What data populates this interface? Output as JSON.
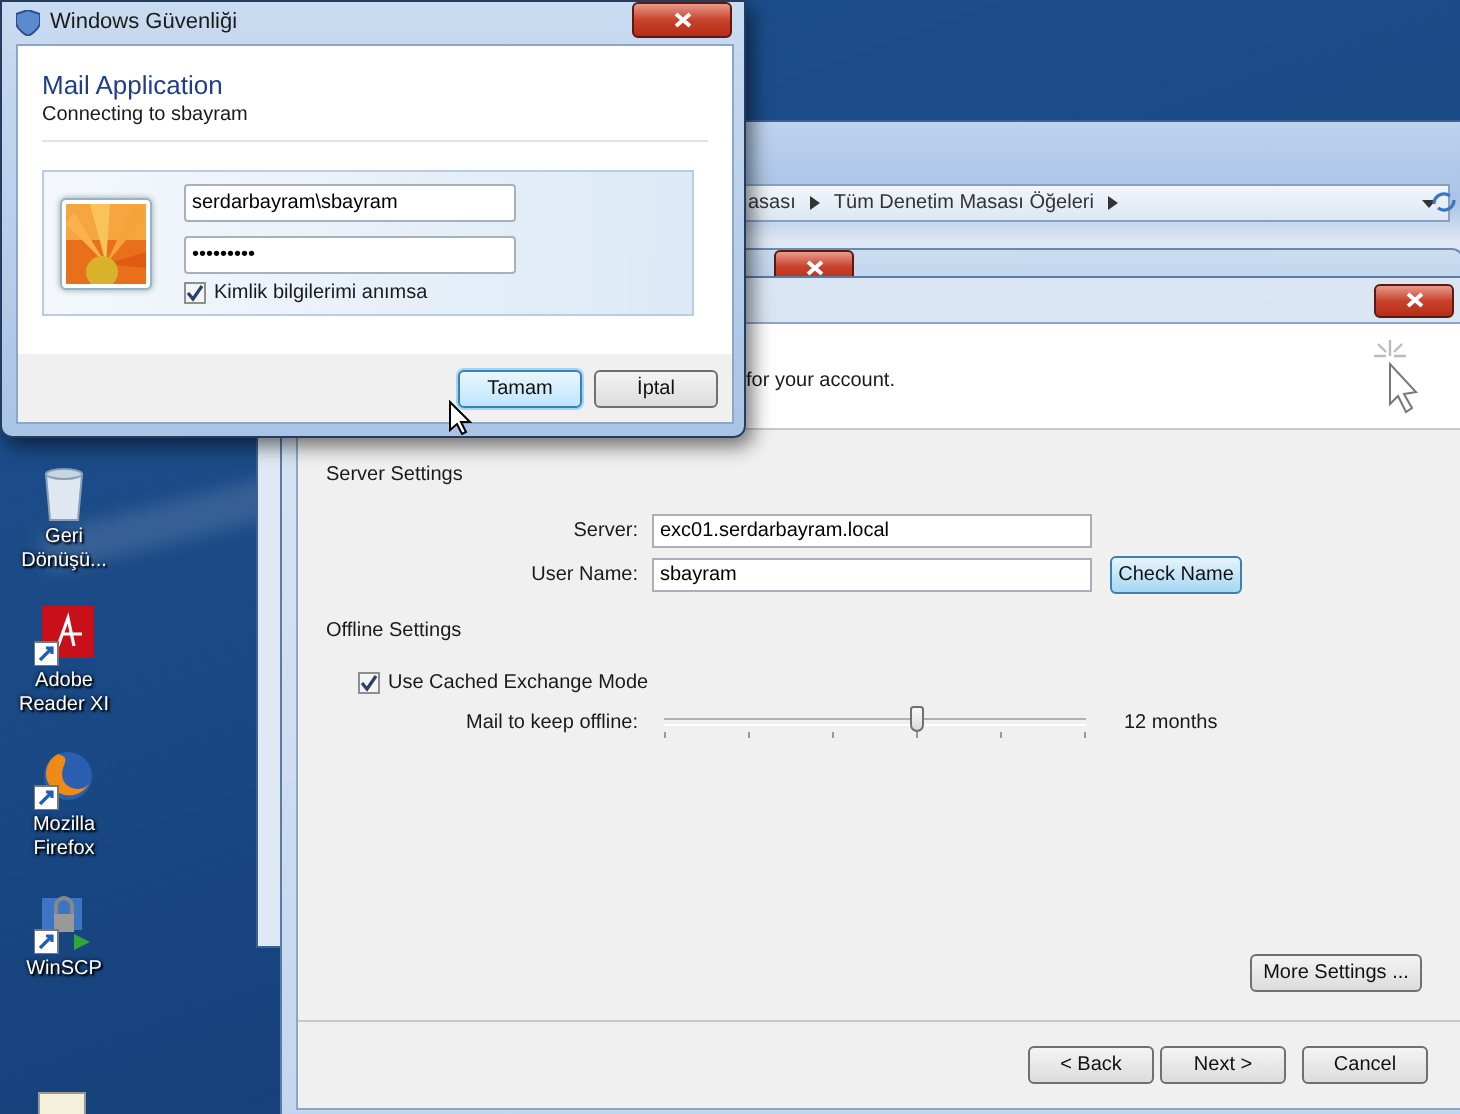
{
  "desktop": {
    "icons": [
      {
        "label": "Geri Dönüşü...",
        "kind": "recycle"
      },
      {
        "label": "Adobe Reader XI",
        "kind": "pdf"
      },
      {
        "label": "Mozilla Firefox",
        "kind": "browser"
      },
      {
        "label": "WinSCP",
        "kind": "transfer"
      }
    ]
  },
  "explorer": {
    "breadcrumbs": [
      "asası",
      "Tüm Denetim Masası Öğeleri"
    ]
  },
  "account_dialog": {
    "header_text": "for your account.",
    "server_settings": {
      "title": "Server Settings",
      "server_label": "Server:",
      "server_value": "exc01.serdarbayram.local",
      "user_label": "User Name:",
      "user_value": "sbayram",
      "check_button": "Check Name"
    },
    "offline_settings": {
      "title": "Offline Settings",
      "cached_mode": {
        "label": "Use Cached Exchange Mode",
        "checked": true
      },
      "slider": {
        "label": "Mail to keep offline:",
        "level": 0.6,
        "reading": "12 months"
      }
    },
    "more_button": "More Settings ...",
    "buttons": [
      "< Back",
      "Next >",
      "Cancel"
    ]
  },
  "security_dialog": {
    "title": "Windows Güvenliği",
    "heading": "Mail Application",
    "subheading": "Connecting to sbayram",
    "username": "serdarbayram\\sbayram",
    "password": "•••••••••",
    "remember": {
      "label": "Kimlik bilgilerimi anımsa",
      "checked": true
    },
    "buttons": [
      {
        "label": "Tamam",
        "selected": true
      },
      {
        "label": "İptal",
        "selected": false
      }
    ]
  }
}
